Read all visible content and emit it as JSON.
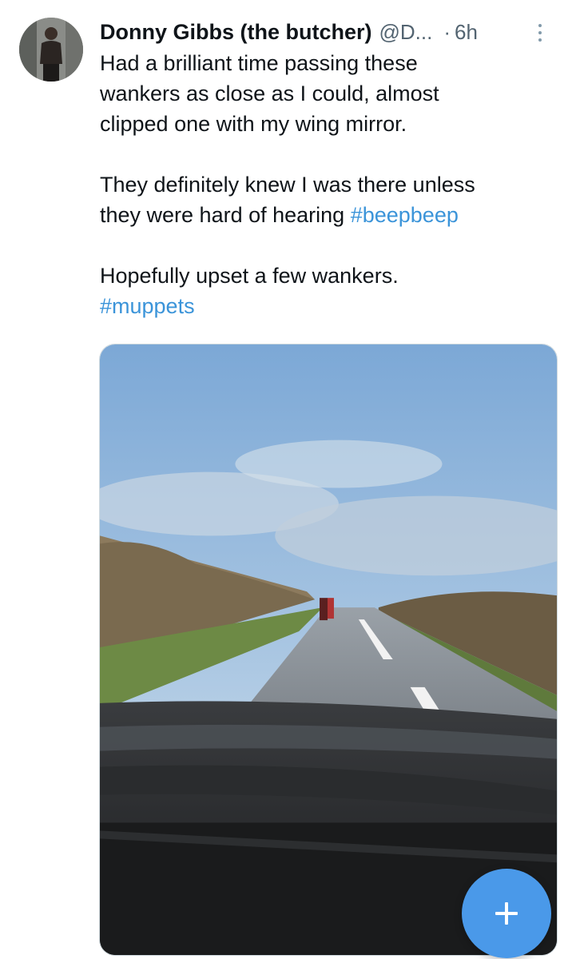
{
  "tweet": {
    "author_name": "Donny Gibbs (the butcher)",
    "handle": "@D...",
    "separator": "·",
    "time": "6h",
    "line1": "Had a brilliant time passing these",
    "line2": "wankers as close as I could, almost",
    "line3": "clipped one with my wing mirror.",
    "line4": "They definitely knew I was there unless",
    "line5_text": "they were hard of hearing ",
    "line5_tag": "#beepbeep",
    "line6": "Hopefully upset a few wankers.",
    "line7_tag": "#muppets"
  },
  "icons": {
    "more": "more-options-icon",
    "compose": "plus-icon"
  },
  "colors": {
    "hashtag": "#3b94d9",
    "secondary_text": "#536471",
    "fab": "#4a99e9"
  }
}
